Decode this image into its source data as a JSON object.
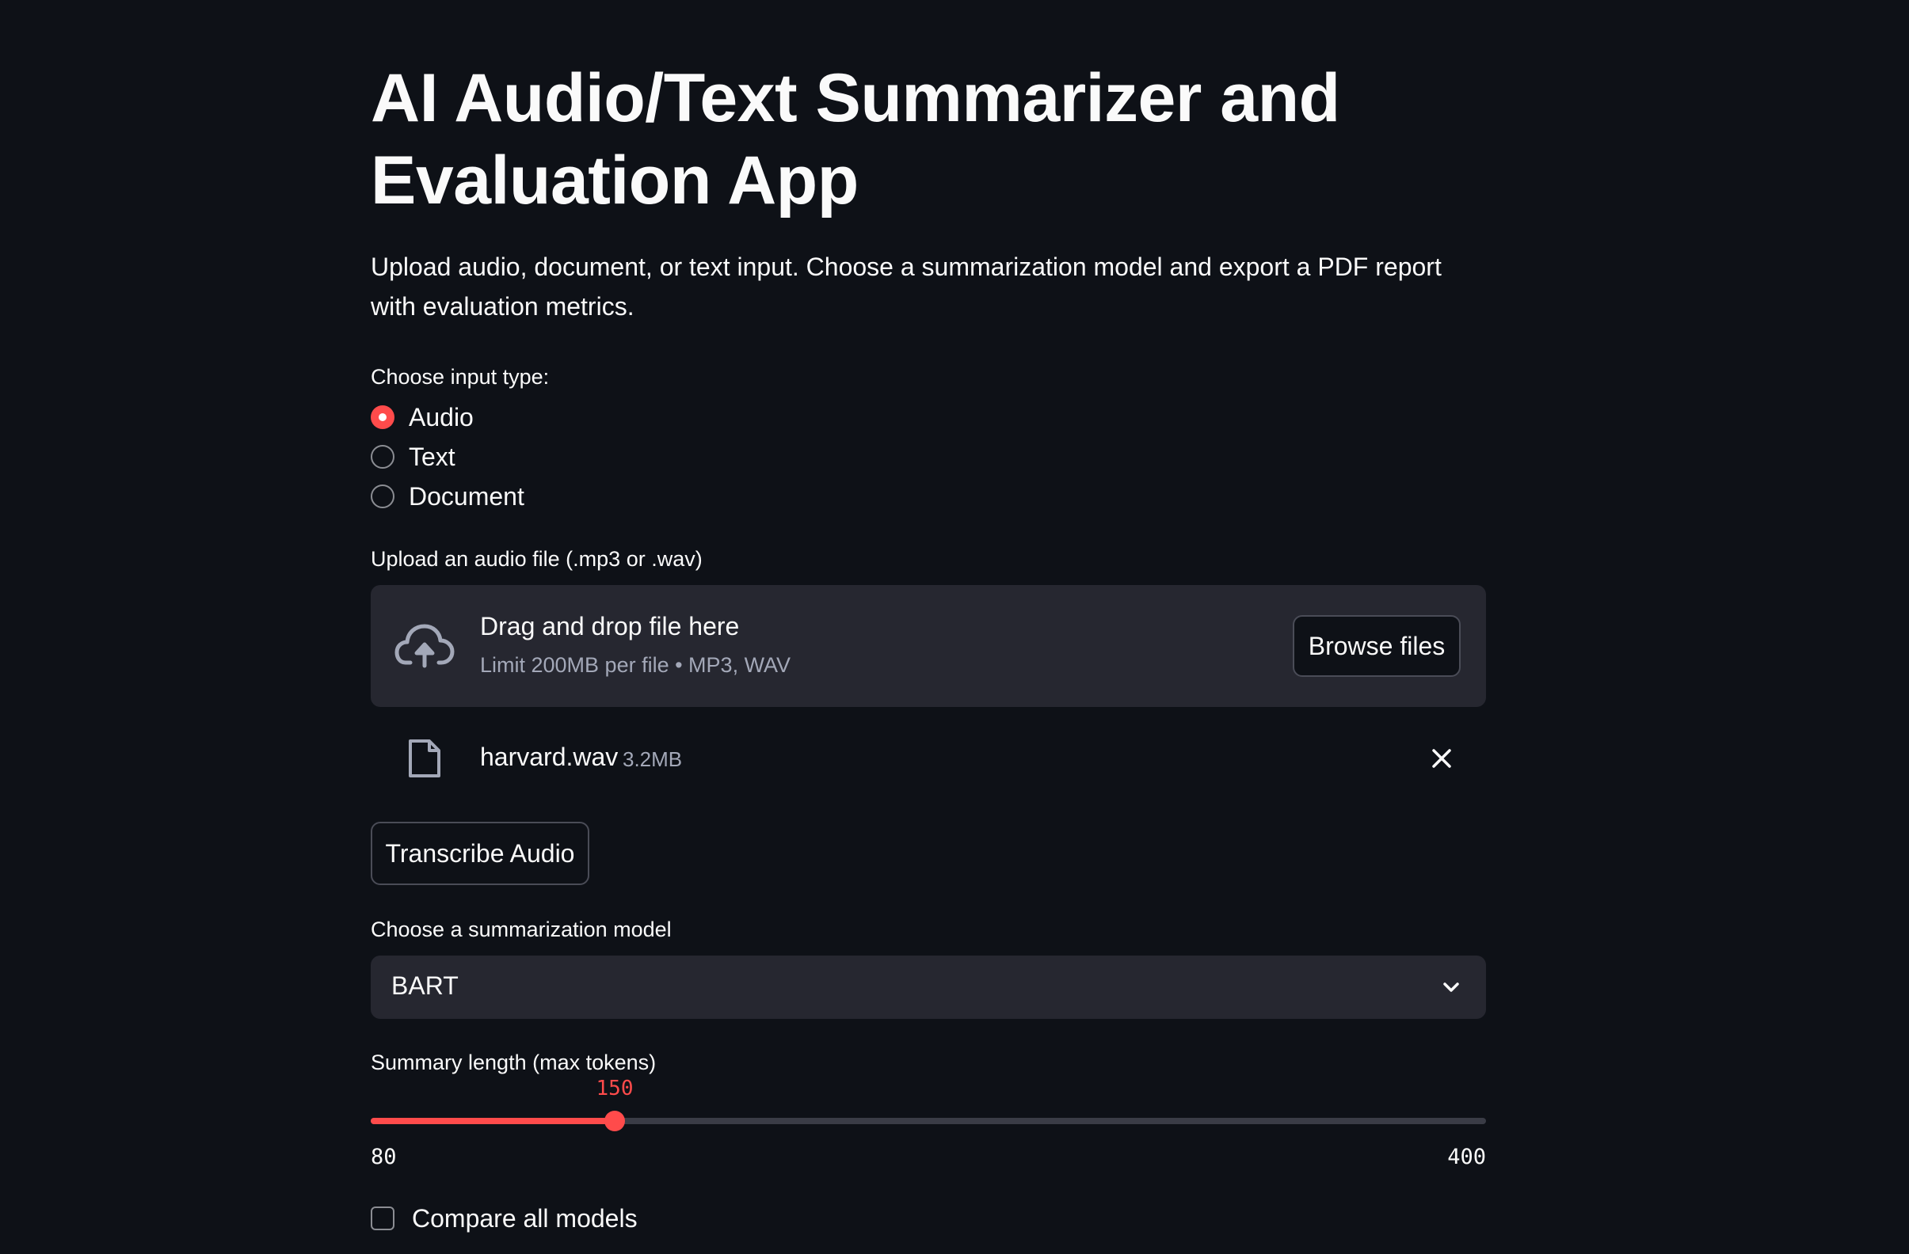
{
  "page": {
    "title": "AI Audio/Text Summarizer and Evaluation App",
    "description": "Upload audio, document, or text input. Choose a summarization model and export a PDF report with evaluation metrics."
  },
  "input_type": {
    "label": "Choose input type:",
    "options": [
      "Audio",
      "Text",
      "Document"
    ],
    "selected": "Audio"
  },
  "uploader": {
    "label": "Upload an audio file (.mp3 or .wav)",
    "drop_title": "Drag and drop file here",
    "drop_subtitle": "Limit 200MB per file • MP3, WAV",
    "browse_label": "Browse files",
    "file": {
      "name": "harvard.wav",
      "size": "3.2MB"
    }
  },
  "transcribe_button": "Transcribe Audio",
  "model_select": {
    "label": "Choose a summarization model",
    "value": "BART"
  },
  "slider": {
    "label": "Summary length (max tokens)",
    "min": 80,
    "max": 400,
    "value": 150
  },
  "compare": {
    "label": "Compare all models",
    "checked": false
  },
  "colors": {
    "background": "#0e1117",
    "accent": "#ff4b4b",
    "widget_bg": "#262730",
    "muted_text": "#a3a8b8"
  },
  "icons": {
    "upload": "cloud-upload-icon",
    "file": "file-icon",
    "remove": "close-icon",
    "dropdown": "chevron-down-icon"
  }
}
